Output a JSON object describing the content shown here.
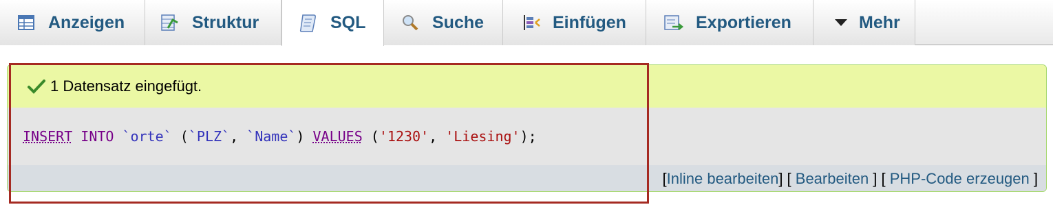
{
  "tabs": [
    {
      "label": "Anzeigen",
      "icon": "table-icon"
    },
    {
      "label": "Struktur",
      "icon": "structure-icon"
    },
    {
      "label": "SQL",
      "icon": "sql-icon",
      "active": true
    },
    {
      "label": "Suche",
      "icon": "search-icon"
    },
    {
      "label": "Einfügen",
      "icon": "insert-icon"
    },
    {
      "label": "Exportieren",
      "icon": "export-icon"
    },
    {
      "label": "Mehr",
      "icon": "chevron-down-icon"
    }
  ],
  "message": {
    "text": "1 Datensatz eingefügt.",
    "icon": "check-icon"
  },
  "sql": {
    "kw_insert": "INSERT",
    "kw_into": "INTO",
    "table": "`orte`",
    "open_paren": " (",
    "col1": "`PLZ`",
    "comma1": ", ",
    "col2": "`Name`",
    "close_paren": ") ",
    "kw_values": "VALUES",
    "open_paren2": " (",
    "val1": "'1230'",
    "comma2": ", ",
    "val2": "'Liesing'",
    "end": ");"
  },
  "actions": {
    "inline_edit": "Inline bearbeiten",
    "edit": "Bearbeiten",
    "php_code": "PHP-Code erzeugen"
  },
  "colors": {
    "link": "#235a81",
    "success_bg": "#ebf8a4",
    "highlight": "#a52a22"
  }
}
